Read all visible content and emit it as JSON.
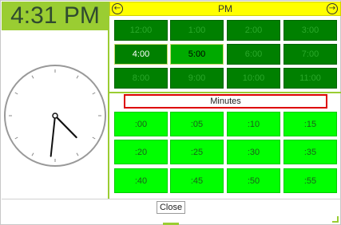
{
  "time_display": "4:31 PM",
  "clock": {
    "hour": 4,
    "minute": 31
  },
  "period_bar": {
    "label": "PM",
    "prev_icon": "arrow-left-circle-icon",
    "next_icon": "arrow-right-circle-icon"
  },
  "hours": [
    "12:00",
    "1:00",
    "2:00",
    "3:00",
    "4:00",
    "5:00",
    "6:00",
    "7:00",
    "8:00",
    "9:00",
    "10:00",
    "11:00"
  ],
  "minutes_label": "Minutes",
  "minutes": [
    ":00",
    ":05",
    ":10",
    ":15",
    ":20",
    ":25",
    ":30",
    ":35",
    ":40",
    ":45",
    ":50",
    ":55"
  ],
  "close_label": "Close",
  "colors": {
    "accent": "#9acd32",
    "period_bar": "#ffff00",
    "hour_button": "#008000",
    "minute_button": "#00ff00",
    "minutes_border": "#dd0000"
  }
}
